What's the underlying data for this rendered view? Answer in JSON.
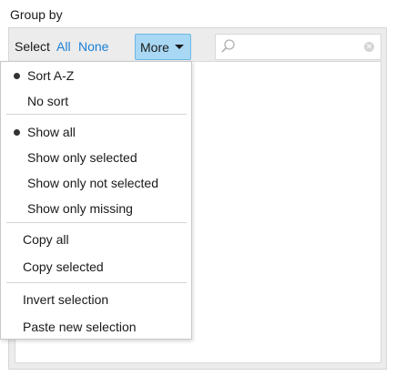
{
  "group_title": "Group by",
  "toolbar": {
    "select_label": "Select",
    "all_link": "All",
    "none_link": "None",
    "more_label": "More",
    "search_placeholder": "",
    "search_value": ""
  },
  "menu": {
    "sort_az": "Sort A-Z",
    "no_sort": "No sort",
    "show_all": "Show all",
    "show_only_selected": "Show only selected",
    "show_only_not_selected": "Show only not selected",
    "show_only_missing": "Show only missing",
    "copy_all": "Copy all",
    "copy_selected": "Copy selected",
    "invert_selection": "Invert selection",
    "paste_new_selection": "Paste new selection",
    "checked": [
      "sort_az",
      "show_all"
    ]
  },
  "icons": {
    "search": "search-icon",
    "clear": "clear-icon",
    "dropdown": "caret-down-icon",
    "bullet": "radio-bullet-icon"
  },
  "colors": {
    "accent_link": "#1a7fd4",
    "button_bg": "#a8d8f4",
    "button_border": "#6fb8e4"
  }
}
